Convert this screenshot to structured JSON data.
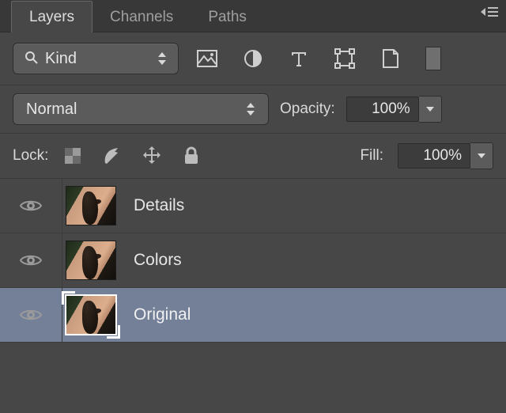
{
  "tabs": {
    "layers": "Layers",
    "channels": "Channels",
    "paths": "Paths",
    "active": "layers"
  },
  "filter": {
    "kind_label": "Kind"
  },
  "blend": {
    "mode": "Normal",
    "opacity_label": "Opacity:",
    "opacity_value": "100%"
  },
  "lock": {
    "label": "Lock:",
    "fill_label": "Fill:",
    "fill_value": "100%"
  },
  "layers": [
    {
      "name": "Details",
      "visible": true,
      "selected": false
    },
    {
      "name": "Colors",
      "visible": true,
      "selected": false
    },
    {
      "name": "Original",
      "visible": true,
      "selected": true
    }
  ]
}
